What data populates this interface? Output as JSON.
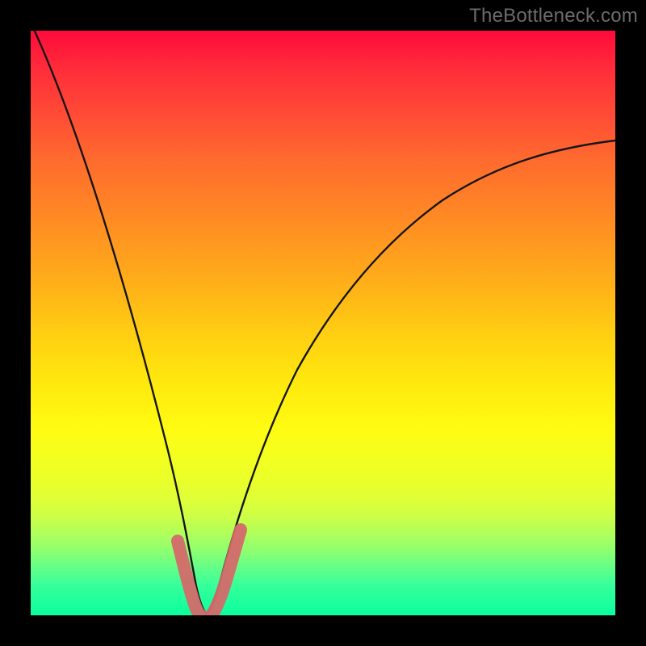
{
  "watermark": {
    "text": "TheBottleneck.com"
  },
  "colors": {
    "background": "#000000",
    "curve_stroke": "#1a1a1a",
    "accent_stroke": "#d46a6a"
  },
  "chart_data": {
    "type": "line",
    "title": "",
    "xlabel": "",
    "ylabel": "",
    "xlim": [
      0,
      100
    ],
    "ylim": [
      0,
      100
    ],
    "grid": false,
    "legend": false,
    "series": [
      {
        "name": "bottleneck-curve",
        "x": [
          0,
          5,
          10,
          15,
          20,
          22,
          24,
          26,
          28,
          30,
          32,
          34,
          36,
          40,
          45,
          50,
          55,
          60,
          65,
          70,
          75,
          80,
          85,
          90,
          95,
          100
        ],
        "y": [
          100,
          83,
          66,
          48,
          29,
          21,
          12,
          5,
          1,
          0,
          1,
          4,
          10,
          20,
          31,
          40,
          47,
          53,
          58,
          62,
          65,
          68,
          70,
          72,
          73,
          74
        ]
      }
    ],
    "annotations": [
      {
        "name": "valley-highlight",
        "x_range": [
          24.5,
          34
        ],
        "note": "thick rounded pink U-shaped marker at curve minimum"
      }
    ],
    "minimum": {
      "x": 30,
      "y": 0
    }
  }
}
